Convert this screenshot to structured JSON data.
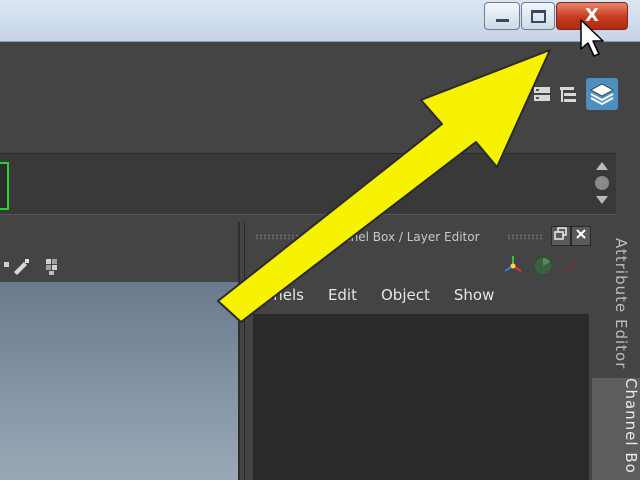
{
  "window": {
    "controls": {
      "minimize": "minimize",
      "maximize": "maximize",
      "close_glyph": "X"
    }
  },
  "toolbar": {
    "icons": [
      "layout-icon",
      "outliner-icon",
      "layers-icon"
    ]
  },
  "channel_box": {
    "title": "nnel Box / Layer Editor",
    "menu": [
      "hannels",
      "Edit",
      "Object",
      "Show"
    ]
  },
  "side_tabs": {
    "attribute_editor": "Attribute Editor",
    "channel_box": "Channel Bo"
  },
  "colors": {
    "highlight_arrow": "#f6f200",
    "close_button": "#c73a1d",
    "active_field_border": "#2ed22e"
  }
}
